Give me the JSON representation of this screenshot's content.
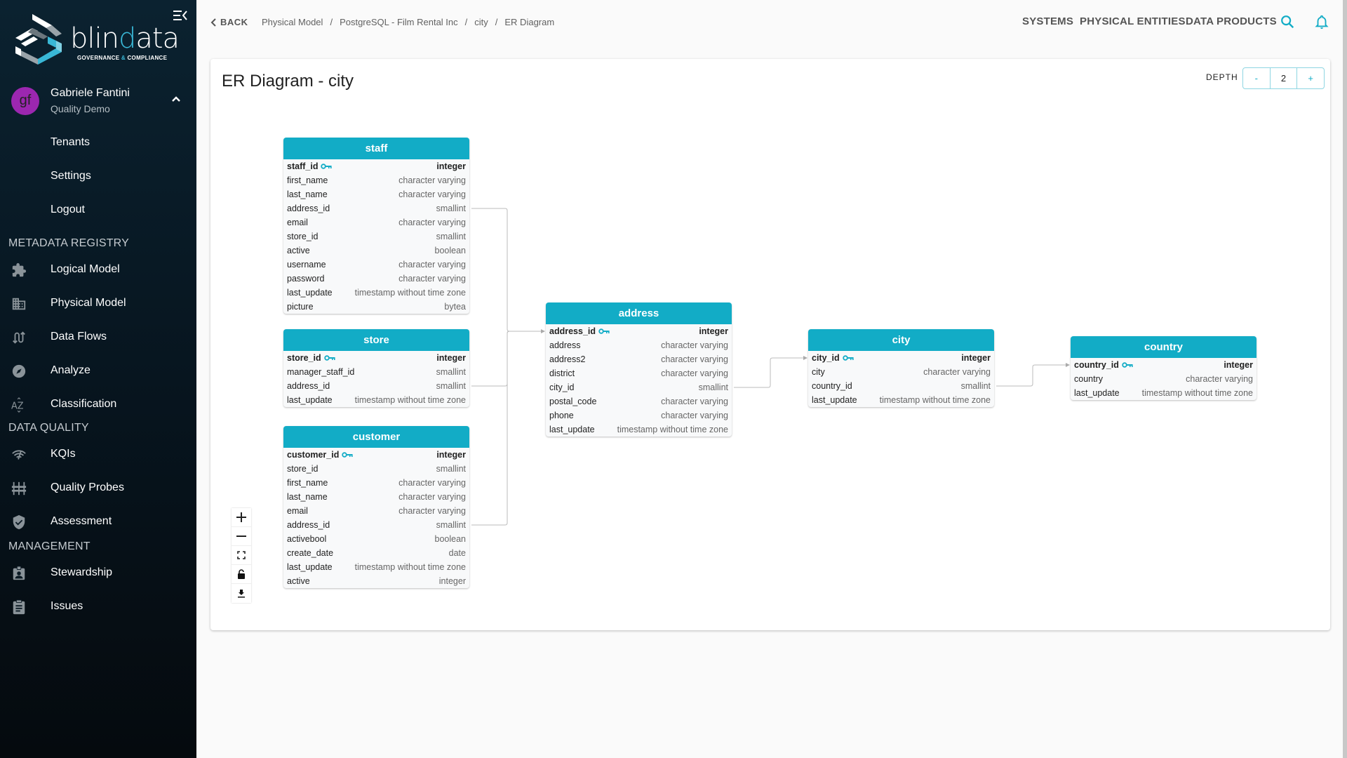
{
  "brand": {
    "name_part1": "blin",
    "name_accent": "d",
    "name_part2": "ata",
    "tagline_part1": "GOVERNANCE",
    "tagline_amp": " & ",
    "tagline_part2": "COMPLIANCE",
    "accent_color": "#39b7d6"
  },
  "user": {
    "initials": "gf",
    "name": "Gabriele Fantini",
    "tenant": "Quality Demo",
    "avatar_color": "#9c27b0",
    "menu": [
      "Tenants",
      "Settings",
      "Logout"
    ]
  },
  "sidebar": {
    "sections": [
      {
        "title": "METADATA REGISTRY",
        "items": [
          {
            "label": "Logical Model",
            "icon": "puzzle-icon"
          },
          {
            "label": "Physical Model",
            "icon": "building-icon"
          },
          {
            "label": "Data Flows",
            "icon": "swap-vertical-icon"
          },
          {
            "label": "Analyze",
            "icon": "compass-icon"
          },
          {
            "label": "Classification",
            "icon": "sort-az-icon"
          }
        ]
      },
      {
        "title": "DATA QUALITY",
        "items": [
          {
            "label": "KQIs",
            "icon": "network-check-icon"
          },
          {
            "label": "Quality Probes",
            "icon": "probes-icon"
          },
          {
            "label": "Assessment",
            "icon": "shield-check-icon"
          }
        ]
      },
      {
        "title": "MANAGEMENT",
        "items": [
          {
            "label": "Stewardship",
            "icon": "badge-icon"
          },
          {
            "label": "Issues",
            "icon": "clipboard-icon"
          }
        ]
      }
    ]
  },
  "topbar": {
    "back_label": "BACK",
    "breadcrumbs": [
      "Physical Model",
      "PostgreSQL - Film Rental Inc",
      "city",
      "ER Diagram"
    ],
    "nav": [
      "SYSTEMS",
      "PHYSICAL ENTITIES",
      "DATA PRODUCTS"
    ]
  },
  "page": {
    "title": "ER Diagram - city",
    "depth_label": "DEPTH",
    "depth_value": "2",
    "depth_dec": "-",
    "depth_inc": "+"
  },
  "er": {
    "header_color": "#12acc6",
    "tables": [
      {
        "name": "staff",
        "columns": [
          {
            "name": "staff_id",
            "type": "integer",
            "pk": true
          },
          {
            "name": "first_name",
            "type": "character varying"
          },
          {
            "name": "last_name",
            "type": "character varying"
          },
          {
            "name": "address_id",
            "type": "smallint"
          },
          {
            "name": "email",
            "type": "character varying"
          },
          {
            "name": "store_id",
            "type": "smallint"
          },
          {
            "name": "active",
            "type": "boolean"
          },
          {
            "name": "username",
            "type": "character varying"
          },
          {
            "name": "password",
            "type": "character varying"
          },
          {
            "name": "last_update",
            "type": "timestamp without time zone"
          },
          {
            "name": "picture",
            "type": "bytea"
          }
        ]
      },
      {
        "name": "store",
        "columns": [
          {
            "name": "store_id",
            "type": "integer",
            "pk": true
          },
          {
            "name": "manager_staff_id",
            "type": "smallint"
          },
          {
            "name": "address_id",
            "type": "smallint"
          },
          {
            "name": "last_update",
            "type": "timestamp without time zone"
          }
        ]
      },
      {
        "name": "customer",
        "columns": [
          {
            "name": "customer_id",
            "type": "integer",
            "pk": true
          },
          {
            "name": "store_id",
            "type": "smallint"
          },
          {
            "name": "first_name",
            "type": "character varying"
          },
          {
            "name": "last_name",
            "type": "character varying"
          },
          {
            "name": "email",
            "type": "character varying"
          },
          {
            "name": "address_id",
            "type": "smallint"
          },
          {
            "name": "activebool",
            "type": "boolean"
          },
          {
            "name": "create_date",
            "type": "date"
          },
          {
            "name": "last_update",
            "type": "timestamp without time zone"
          },
          {
            "name": "active",
            "type": "integer"
          }
        ]
      },
      {
        "name": "address",
        "columns": [
          {
            "name": "address_id",
            "type": "integer",
            "pk": true
          },
          {
            "name": "address",
            "type": "character varying"
          },
          {
            "name": "address2",
            "type": "character varying"
          },
          {
            "name": "district",
            "type": "character varying"
          },
          {
            "name": "city_id",
            "type": "smallint"
          },
          {
            "name": "postal_code",
            "type": "character varying"
          },
          {
            "name": "phone",
            "type": "character varying"
          },
          {
            "name": "last_update",
            "type": "timestamp without time zone"
          }
        ]
      },
      {
        "name": "city",
        "columns": [
          {
            "name": "city_id",
            "type": "integer",
            "pk": true
          },
          {
            "name": "city",
            "type": "character varying"
          },
          {
            "name": "country_id",
            "type": "smallint"
          },
          {
            "name": "last_update",
            "type": "timestamp without time zone"
          }
        ]
      },
      {
        "name": "country",
        "columns": [
          {
            "name": "country_id",
            "type": "integer",
            "pk": true
          },
          {
            "name": "country",
            "type": "character varying"
          },
          {
            "name": "last_update",
            "type": "timestamp without time zone"
          }
        ]
      }
    ],
    "relations": [
      {
        "from": "staff.address_id",
        "to": "address.address_id"
      },
      {
        "from": "store.address_id",
        "to": "address.address_id"
      },
      {
        "from": "customer.address_id",
        "to": "address.address_id"
      },
      {
        "from": "address.city_id",
        "to": "city.city_id"
      },
      {
        "from": "city.country_id",
        "to": "country.country_id"
      }
    ],
    "controls": [
      "zoom-in",
      "zoom-out",
      "fit-view",
      "lock",
      "download"
    ]
  }
}
